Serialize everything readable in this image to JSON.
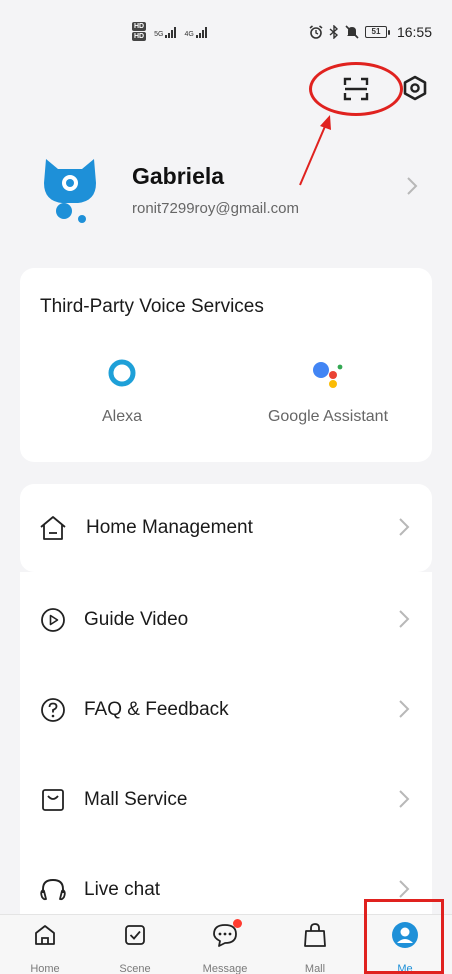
{
  "status_bar": {
    "hd1": "HD",
    "hd2": "HD",
    "net1": "5G",
    "net2": "4G",
    "battery": "51",
    "time": "16:55"
  },
  "profile": {
    "name": "Gabriela",
    "email": "ronit7299roy@gmail.com"
  },
  "voice_services": {
    "title": "Third-Party Voice Services",
    "items": [
      {
        "label": "Alexa",
        "icon": "alexa-icon"
      },
      {
        "label": "Google Assistant",
        "icon": "google-assistant-icon"
      }
    ]
  },
  "menu": {
    "home_management": "Home Management",
    "items": [
      {
        "label": "Guide Video",
        "icon": "play-circle-icon"
      },
      {
        "label": "FAQ & Feedback",
        "icon": "question-circle-icon"
      },
      {
        "label": "Mall Service",
        "icon": "bag-icon"
      },
      {
        "label": "Live chat",
        "icon": "headset-icon"
      }
    ]
  },
  "bottom_nav": {
    "items": [
      {
        "label": "Home",
        "icon": "home-icon"
      },
      {
        "label": "Scene",
        "icon": "check-square-icon"
      },
      {
        "label": "Message",
        "icon": "chat-icon"
      },
      {
        "label": "Mall",
        "icon": "shopping-bag-icon"
      },
      {
        "label": "Me",
        "icon": "person-icon"
      }
    ],
    "active": "Me"
  },
  "colors": {
    "accent": "#1e90d8",
    "annotation": "#e0221f",
    "background": "#f4f4f6"
  }
}
